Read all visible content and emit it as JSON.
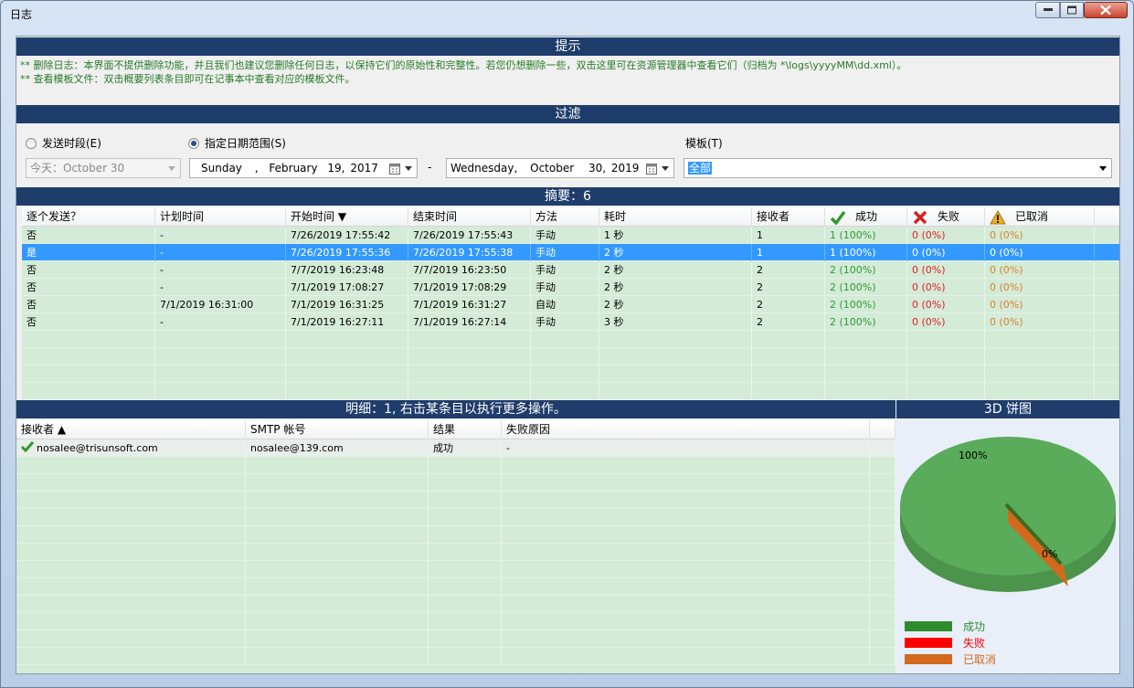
{
  "window": {
    "title": "日志"
  },
  "tips": {
    "header": "提示",
    "line1": "** 删除日志：本界面不提供删除功能，并且我们也建议您删除任何日志，以保持它们的原始性和完整性。若您仍想删除一些，双击这里可在资源管理器中查看它们（归档为 *\\logs\\yyyyMM\\dd.xml）。",
    "line2": "** 查看模板文件：双击概要列表条目即可在记事本中查看对应的模板文件。"
  },
  "filter": {
    "header": "过滤",
    "radio_period": {
      "label": "发送时段(E)",
      "checked": false
    },
    "radio_range": {
      "label": "指定日期范围(S)",
      "checked": true
    },
    "period_value": "今天：October 30",
    "date_from": {
      "weekday": "Sunday",
      "sep": ",",
      "month": "February",
      "day": "19,",
      "year": "2017"
    },
    "dash": "-",
    "date_to": {
      "weekday": "Wednesday,",
      "month": "October",
      "day": "30,",
      "year": "2019"
    },
    "template_label": "模板(T)",
    "template_value": "全部"
  },
  "summary": {
    "header": "摘要：6",
    "columns": [
      "逐个发送？",
      "计划时间",
      "开始时间 ▼",
      "结束时间",
      "方法",
      "耗时",
      "接收者",
      "成功",
      "失败",
      "已取消"
    ],
    "rows": [
      [
        "否",
        "-",
        "7/26/2019 17:55:42",
        "7/26/2019 17:55:43",
        "手动",
        "1 秒",
        "1",
        "1 (100%)",
        "0 (0%)",
        "0 (0%)"
      ],
      [
        "是",
        "-",
        "7/26/2019 17:55:36",
        "7/26/2019 17:55:38",
        "手动",
        "2 秒",
        "1",
        "1 (100%)",
        "0 (0%)",
        "0 (0%)"
      ],
      [
        "否",
        "-",
        "7/7/2019 16:23:48",
        "7/7/2019 16:23:50",
        "手动",
        "2 秒",
        "2",
        "2 (100%)",
        "0 (0%)",
        "0 (0%)"
      ],
      [
        "否",
        "-",
        "7/1/2019 17:08:27",
        "7/1/2019 17:08:29",
        "手动",
        "2 秒",
        "2",
        "2 (100%)",
        "0 (0%)",
        "0 (0%)"
      ],
      [
        "否",
        "7/1/2019 16:31:00",
        "7/1/2019 16:31:25",
        "7/1/2019 16:31:27",
        "自动",
        "2 秒",
        "2",
        "2 (100%)",
        "0 (0%)",
        "0 (0%)"
      ],
      [
        "否",
        "-",
        "7/1/2019 16:27:11",
        "7/1/2019 16:27:14",
        "手动",
        "3 秒",
        "2",
        "2 (100%)",
        "0 (0%)",
        "0 (0%)"
      ]
    ],
    "selected_row": 1
  },
  "detail": {
    "header": "明细：1, 右击某条目以执行更多操作。",
    "columns": [
      "接收者 ▲",
      "SMTP 帐号",
      "结果",
      "失败原因"
    ],
    "rows": [
      [
        "nosalee@trisunsoft.com",
        "nosalee@139.com",
        "成功",
        "-"
      ]
    ]
  },
  "pie": {
    "header": "3D 饼图",
    "label_success": "100%",
    "label_zero": "0%",
    "legend": [
      {
        "label": "成功",
        "color": "#2e8b2e"
      },
      {
        "label": "失败",
        "color": "#ff0000"
      },
      {
        "label": "已取消",
        "color": "#d2691e"
      }
    ]
  },
  "colors": {
    "section_bar": "#1f3d6b",
    "grid_bg": "#d4ebd8",
    "selection": "#3399ff",
    "pie_green": "#5aab5a"
  }
}
